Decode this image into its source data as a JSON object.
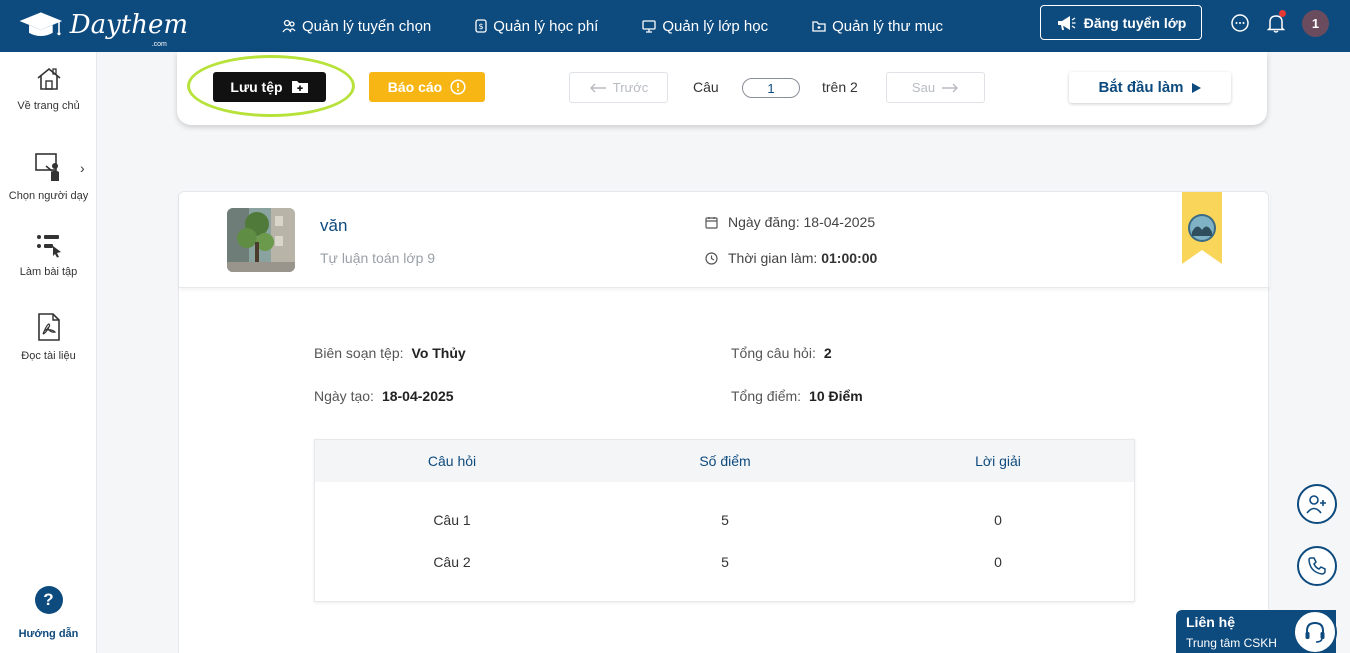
{
  "brand": {
    "name": "Daythem",
    "suffix": ".com"
  },
  "nav": [
    {
      "label": "Quản lý tuyển chọn",
      "icon": "users-icon"
    },
    {
      "label": "Quản lý học phí",
      "icon": "tuition-icon"
    },
    {
      "label": "Quản lý lớp học",
      "icon": "classroom-icon"
    },
    {
      "label": "Quản lý thư mục",
      "icon": "folder-icon"
    }
  ],
  "header": {
    "post_label": "Đăng tuyển lớp",
    "avatar_initial": "1"
  },
  "sidebar": {
    "items": [
      {
        "label": "Về trang chủ",
        "icon": "home-icon"
      },
      {
        "label": "Chọn người dạy",
        "icon": "teacher-icon"
      },
      {
        "label": "Làm bài tập",
        "icon": "exercise-icon"
      },
      {
        "label": "Đọc tài liệu",
        "icon": "pdf-icon"
      }
    ],
    "help_label": "Hướng dẫn"
  },
  "toolbar": {
    "save_label": "Lưu tệp",
    "report_label": "Báo cáo",
    "prev_label": "Trước",
    "next_label": "Sau",
    "question_label": "Câu",
    "question_value": "1",
    "total_label": "trên 2",
    "start_label": "Bắt đầu làm"
  },
  "file": {
    "title": "văn",
    "subtitle": "Tự luận toán lớp 9",
    "posted_label": "Ngày đăng:",
    "posted_value": "18-04-2025",
    "duration_label": "Thời gian làm:",
    "duration_value": "01:00:00"
  },
  "details": {
    "author_label": "Biên soạn tệp:",
    "author_value": "Vo Thủy",
    "created_label": "Ngày tạo:",
    "created_value": "18-04-2025",
    "questions_label": "Tổng câu hỏi:",
    "questions_value": "2",
    "score_label": "Tổng điểm:",
    "score_value": "10 Điểm"
  },
  "table": {
    "headers": [
      "Câu hỏi",
      "Số điểm",
      "Lời giải"
    ],
    "rows": [
      [
        "Câu 1",
        "5",
        "0"
      ],
      [
        "Câu 2",
        "5",
        "0"
      ]
    ]
  },
  "contact": {
    "title": "Liên hệ",
    "subtitle": "Trung tâm CSKH"
  },
  "colors": {
    "primary": "#0d4a7e",
    "accent": "#f7b614",
    "highlight": "#b7e23a"
  }
}
